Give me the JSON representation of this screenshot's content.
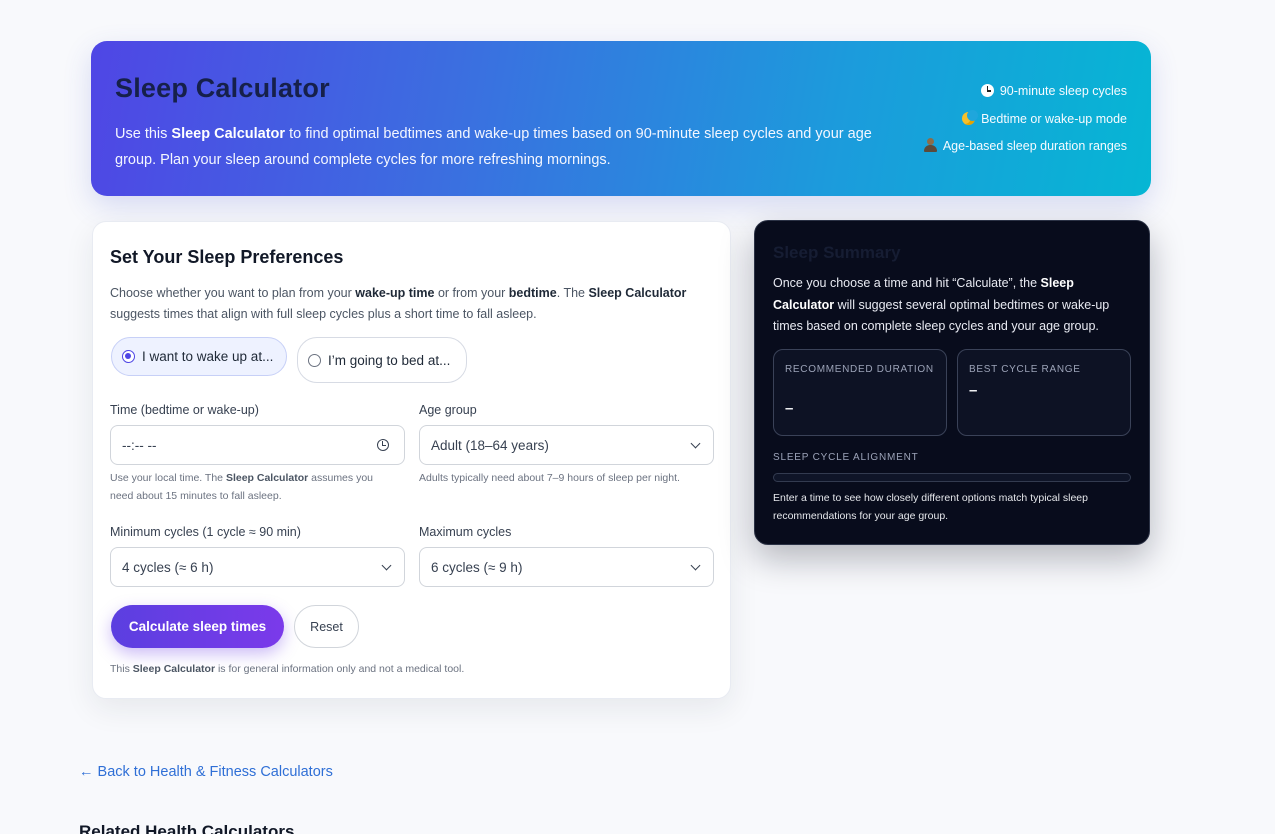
{
  "header": {
    "title": "Sleep Calculator",
    "intro_prefix": "Use this ",
    "intro_bold": "Sleep Calculator",
    "intro_suffix": " to find optimal bedtimes and wake-up times based on 90-minute sleep cycles and your age group. Plan your sleep around complete cycles for more refreshing mornings.",
    "features": [
      {
        "icon": "clock-icon",
        "label": "90-minute sleep cycles"
      },
      {
        "icon": "moon-icon",
        "label": "Bedtime or wake-up mode"
      },
      {
        "icon": "person-icon",
        "label": "Age-based sleep duration ranges"
      }
    ]
  },
  "form": {
    "title": "Set Your Sleep Preferences",
    "desc_1": "Choose whether you want to plan from your ",
    "desc_b1": "wake-up time",
    "desc_2": " or from your ",
    "desc_b2": "bedtime",
    "desc_3": ". The ",
    "desc_b3": "Sleep Calculator",
    "desc_4": " suggests times that align with full sleep cycles plus a short time to fall asleep.",
    "mode_options": [
      {
        "label": "I want to wake up at...",
        "selected": true
      },
      {
        "label": "I’m going to bed at...",
        "selected": false
      }
    ],
    "time_label": "Time (bedtime or wake-up)",
    "time_value": "--:-- --",
    "time_help_1": "Use your local time. The ",
    "time_help_b": "Sleep Calculator",
    "time_help_2": " assumes you need about 15 minutes to fall asleep.",
    "age_label": "Age group",
    "age_value": "Adult (18–64 years)",
    "age_help": "Adults typically need about 7–9 hours of sleep per night.",
    "min_label": "Minimum cycles (1 cycle ≈ 90 min)",
    "min_value": "4 cycles (≈ 6 h)",
    "max_label": "Maximum cycles",
    "max_value": "6 cycles (≈ 9 h)",
    "calculate_label": "Calculate sleep times",
    "reset_label": "Reset",
    "disclaimer_1": "This ",
    "disclaimer_b": "Sleep Calculator",
    "disclaimer_2": " is for general information only and not a medical tool."
  },
  "summary": {
    "title": "Sleep Summary",
    "desc_1": "Once you choose a time and hit “Calculate”, the ",
    "desc_b": "Sleep Calculator",
    "desc_2": " will suggest several optimal bedtimes or wake-up times based on complete sleep cycles and your age group.",
    "recommended_label": "RECOMMENDED DURATION",
    "recommended_value": "–",
    "best_range_label": "BEST CYCLE RANGE",
    "best_range_value": "–",
    "alignment_label": "SLEEP CYCLE ALIGNMENT",
    "alignment_fraction": 0,
    "note": "Enter a time to see how closely different options match typical sleep recommendations for your age group."
  },
  "footer": {
    "back_link": "← Back to Health & Fitness Calculators",
    "related_title": "Related Health Calculators"
  },
  "colors": {
    "accent": "#4f46e5",
    "button_gradient_start": "#5b3fe0",
    "button_gradient_end": "#7b3aea",
    "link": "#2f6fd6",
    "summary_bg": "#080c1c"
  }
}
